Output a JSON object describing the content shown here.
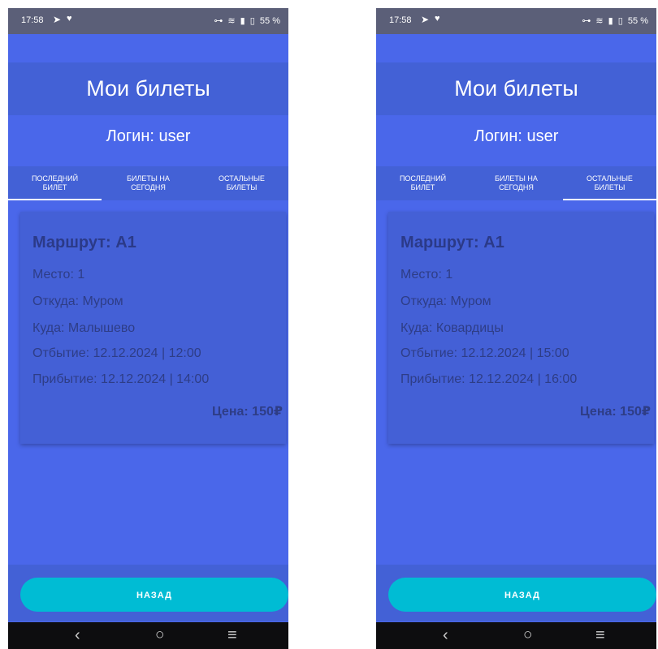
{
  "status_bar": {
    "time": "17:58",
    "icons_right": [
      "key-icon",
      "volte-icon",
      "wifi-icon",
      "signal-icon",
      "battery-icon"
    ],
    "battery": "55 %"
  },
  "screen": {
    "title": "Мои билеты",
    "login": "Логин: user",
    "tabs": [
      "ПОСЛЕДНИЙ\nБИЛЕТ",
      "БИЛЕТЫ НА\nСЕГОДНЯ",
      "ОСТАЛЬНЫЕ\nБИЛЕТЫ"
    ],
    "back_button": "НАЗАД"
  },
  "colors": {
    "background": "#4a67ea",
    "panel": "#4361d6",
    "button": "#00bcd4",
    "status_bar": "#5b5f78",
    "nav_bar": "#0d0d0f"
  },
  "phones": [
    {
      "active_tab": 0,
      "ticket": {
        "route": "Маршрут: А1",
        "seat": "Место: 1",
        "from": "Откуда: Муром",
        "to": "Куда: Малышево",
        "departure": "Отбытие: 12.12.2024 | 12:00",
        "arrival": "Прибытие: 12.12.2024 | 14:00",
        "price": "Цена: 150₽"
      }
    },
    {
      "active_tab": 2,
      "ticket": {
        "route": "Маршрут: А1",
        "seat": "Место: 1",
        "from": "Откуда: Муром",
        "to": "Куда: Ковардицы",
        "departure": "Отбытие: 12.12.2024 | 15:00",
        "arrival": "Прибытие: 12.12.2024 | 16:00",
        "price": "Цена: 150₽"
      }
    }
  ]
}
